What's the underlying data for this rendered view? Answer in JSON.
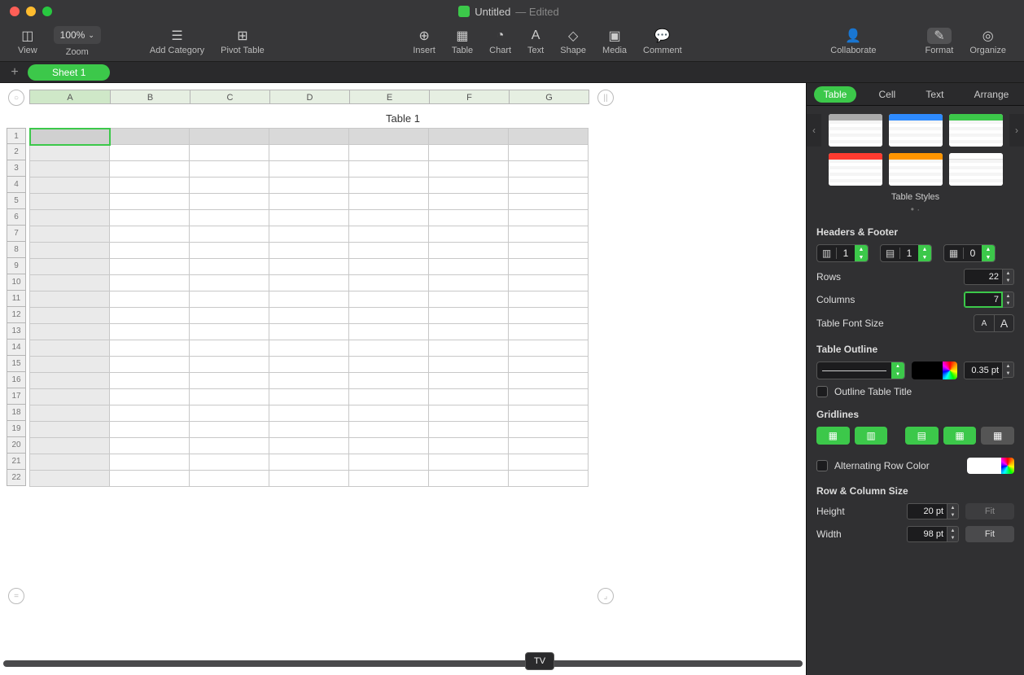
{
  "titlebar": {
    "doc_name": "Untitled",
    "status": "— Edited"
  },
  "toolbar": {
    "view": "View",
    "zoom_value": "100%",
    "zoom_label": "Zoom",
    "add_category": "Add Category",
    "pivot": "Pivot Table",
    "insert": "Insert",
    "table": "Table",
    "chart": "Chart",
    "text": "Text",
    "shape": "Shape",
    "media": "Media",
    "comment": "Comment",
    "collaborate": "Collaborate",
    "format": "Format",
    "organize": "Organize"
  },
  "sheets": {
    "tab1": "Sheet 1"
  },
  "spreadsheet": {
    "table_title": "Table 1",
    "columns": [
      "A",
      "B",
      "C",
      "D",
      "E",
      "F",
      "G"
    ],
    "row_count": 22
  },
  "tooltip": "TV",
  "inspector": {
    "tabs": {
      "table": "Table",
      "cell": "Cell",
      "text": "Text",
      "arrange": "Arrange"
    },
    "styles_label": "Table Styles",
    "headers_footer": {
      "title": "Headers & Footer",
      "header_rows": "1",
      "header_cols": "1",
      "footer_rows": "0"
    },
    "rows": {
      "label": "Rows",
      "value": "22"
    },
    "columns": {
      "label": "Columns",
      "value": "7"
    },
    "font_size_label": "Table Font Size",
    "outline": {
      "title": "Table Outline",
      "weight": "0.35 pt",
      "checkbox": "Outline Table Title"
    },
    "gridlines": {
      "title": "Gridlines"
    },
    "alt_row": {
      "label": "Alternating Row Color"
    },
    "size": {
      "title": "Row & Column Size",
      "height_label": "Height",
      "height_val": "20 pt",
      "width_label": "Width",
      "width_val": "98 pt",
      "fit": "Fit"
    }
  }
}
